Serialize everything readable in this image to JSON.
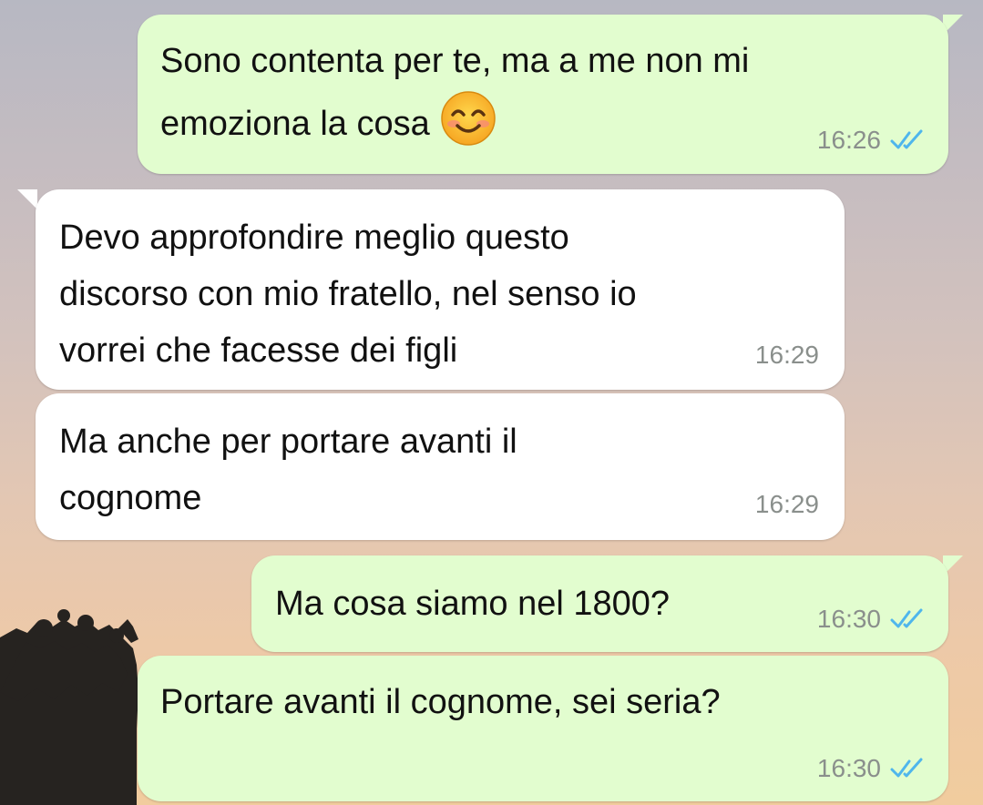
{
  "colors": {
    "outgoing_bubble": "#e2fdcf",
    "incoming_bubble": "#ffffff",
    "read_ticks": "#4fb6ec",
    "timestamp": "#8a8f8c",
    "text": "#111111"
  },
  "messages": [
    {
      "direction": "outgoing",
      "text": "Sono contenta per te, ma a me non mi\nemoziona la cosa",
      "emoji": "smiling-face-with-smiling-eyes",
      "time": "16:26",
      "status_icon": "double-check-read-icon"
    },
    {
      "direction": "incoming",
      "text": "Devo approfondire meglio questo\ndiscorso con mio fratello, nel senso io\nvorrei che facesse dei figli",
      "time": "16:29"
    },
    {
      "direction": "incoming",
      "text": "Ma anche per portare avanti il\ncognome",
      "time": "16:29"
    },
    {
      "direction": "outgoing",
      "text": "Ma cosa siamo nel 1800?",
      "time": "16:30",
      "status_icon": "double-check-read-icon"
    },
    {
      "direction": "outgoing",
      "text": "Portare avanti il cognome, sei seria?",
      "time": "16:30",
      "status_icon": "double-check-read-icon"
    }
  ]
}
